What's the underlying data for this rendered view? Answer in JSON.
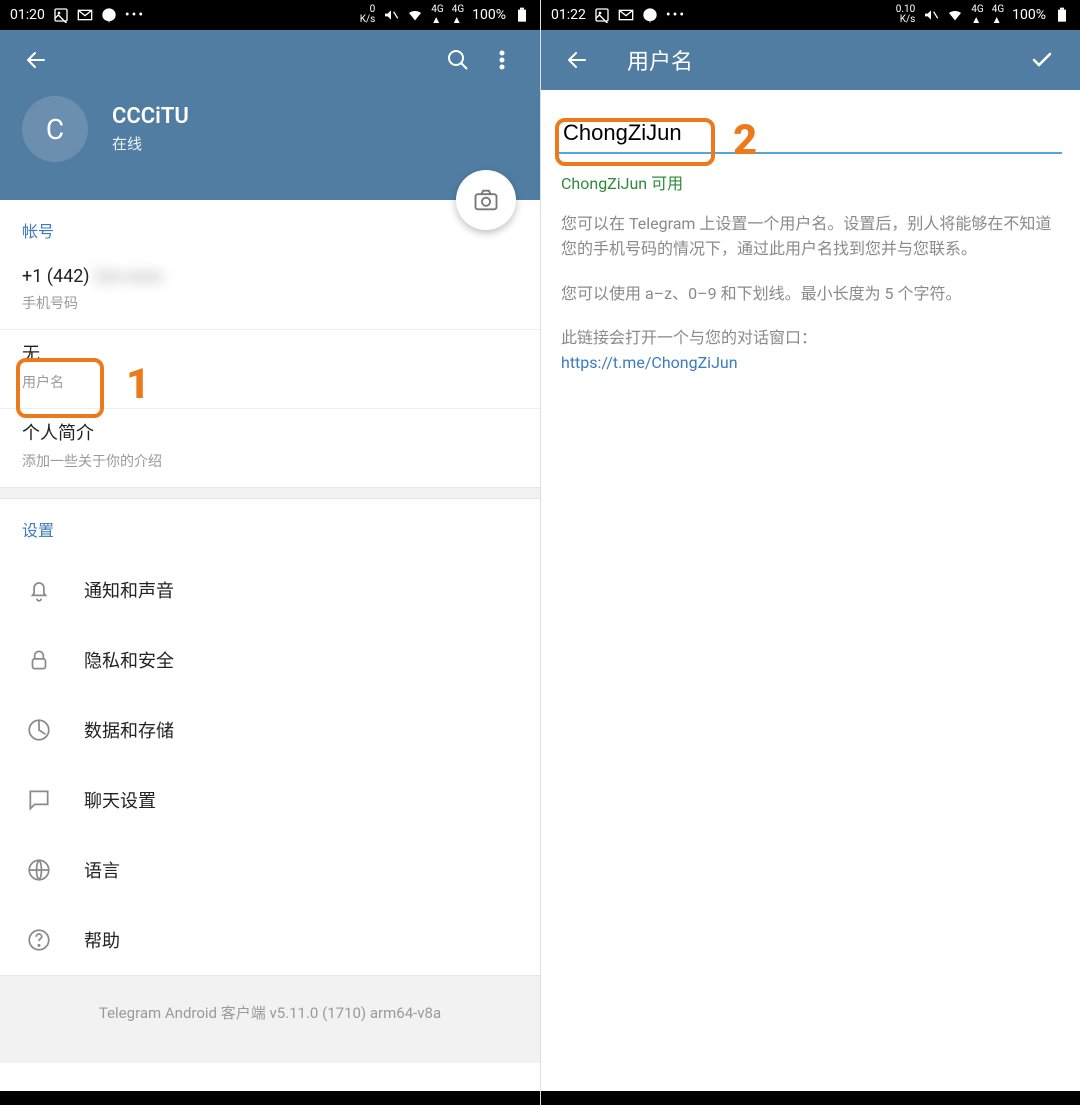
{
  "left": {
    "status": {
      "time": "01:20",
      "speed_top": "0",
      "speed_unit": "K/s",
      "battery": "100%"
    },
    "profile": {
      "avatar_letter": "C",
      "name": "CCCiTU",
      "status": "在线"
    },
    "account": {
      "section": "帐号",
      "phone_prefix": "+1 (442) ",
      "phone_rest": "2xx-xxxx",
      "phone_label": "手机号码",
      "username_value": "无",
      "username_label": "用户名",
      "bio_title": "个人简介",
      "bio_sub": "添加一些关于你的介绍"
    },
    "settings": {
      "section": "设置",
      "items": [
        {
          "label": "通知和声音"
        },
        {
          "label": "隐私和安全"
        },
        {
          "label": "数据和存储"
        },
        {
          "label": "聊天设置"
        },
        {
          "label": "语言"
        },
        {
          "label": "帮助"
        }
      ]
    },
    "version": "Telegram Android 客户端 v5.11.0 (1710) arm64-v8a",
    "annotation": "1"
  },
  "right": {
    "status": {
      "time": "01:22",
      "speed_top": "0.10",
      "speed_unit": "K/s",
      "battery": "100%"
    },
    "header_title": "用户名",
    "username_input": "ChongZiJun",
    "avail": "ChongZiJun 可用",
    "desc1": "您可以在 Telegram 上设置一个用户名。设置后，别人将能够在不知道您的手机号码的情况下，通过此用户名找到您并与您联系。",
    "desc2": "您可以使用 a–z、0–9 和下划线。最小长度为 5 个字符。",
    "desc3": "此链接会打开一个与您的对话窗口：",
    "link": "https://t.me/ChongZiJun",
    "annotation": "2"
  }
}
